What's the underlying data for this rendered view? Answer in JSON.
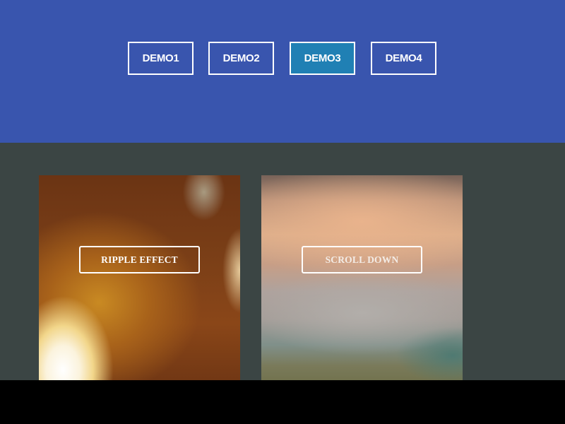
{
  "nav": {
    "buttons": [
      {
        "label": "DEMO1",
        "active": false
      },
      {
        "label": "DEMO2",
        "active": false
      },
      {
        "label": "DEMO3",
        "active": true
      },
      {
        "label": "DEMO4",
        "active": false
      }
    ]
  },
  "cards": [
    {
      "button_label": "RIPPLE EFFECT"
    },
    {
      "button_label": "SCROLL DOWN"
    }
  ],
  "colors": {
    "header_bg": "#3955ae",
    "active_button_bg": "#2080b4",
    "content_bg": "#3b4544"
  }
}
